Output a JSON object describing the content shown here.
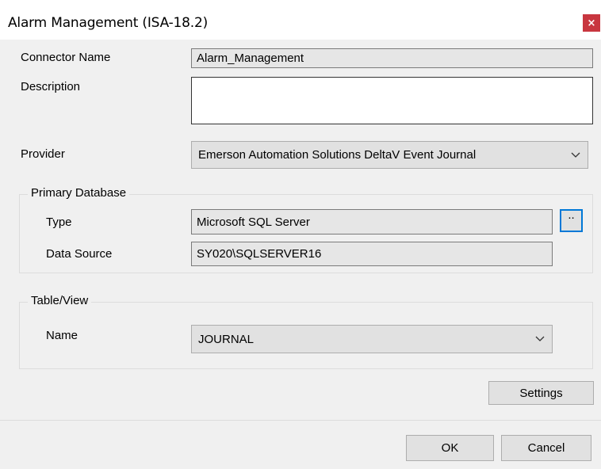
{
  "window": {
    "title": "Alarm Management (ISA-18.2)",
    "close_glyph": "×"
  },
  "form": {
    "connector_name_label": "Connector Name",
    "connector_name_value": "Alarm_Management",
    "description_label": "Description",
    "description_value": "",
    "provider_label": "Provider",
    "provider_value": "Emerson Automation Solutions DeltaV Event Journal"
  },
  "primary_database": {
    "group_title": "Primary Database",
    "type_label": "Type",
    "type_value": "Microsoft SQL Server",
    "browse_label": "..",
    "data_source_label": "Data Source",
    "data_source_value": "SY020\\SQLSERVER16"
  },
  "table_view": {
    "group_title": "Table/View",
    "name_label": "Name",
    "name_value": "JOURNAL"
  },
  "buttons": {
    "settings": "Settings",
    "ok": "OK",
    "cancel": "Cancel"
  },
  "icons": {
    "close": "close-icon",
    "dropdown": "chevron-down-icon"
  },
  "colors": {
    "close_button": "#c8363f",
    "focus_border": "#0078d7",
    "dialog_background": "#f0f0f0"
  }
}
